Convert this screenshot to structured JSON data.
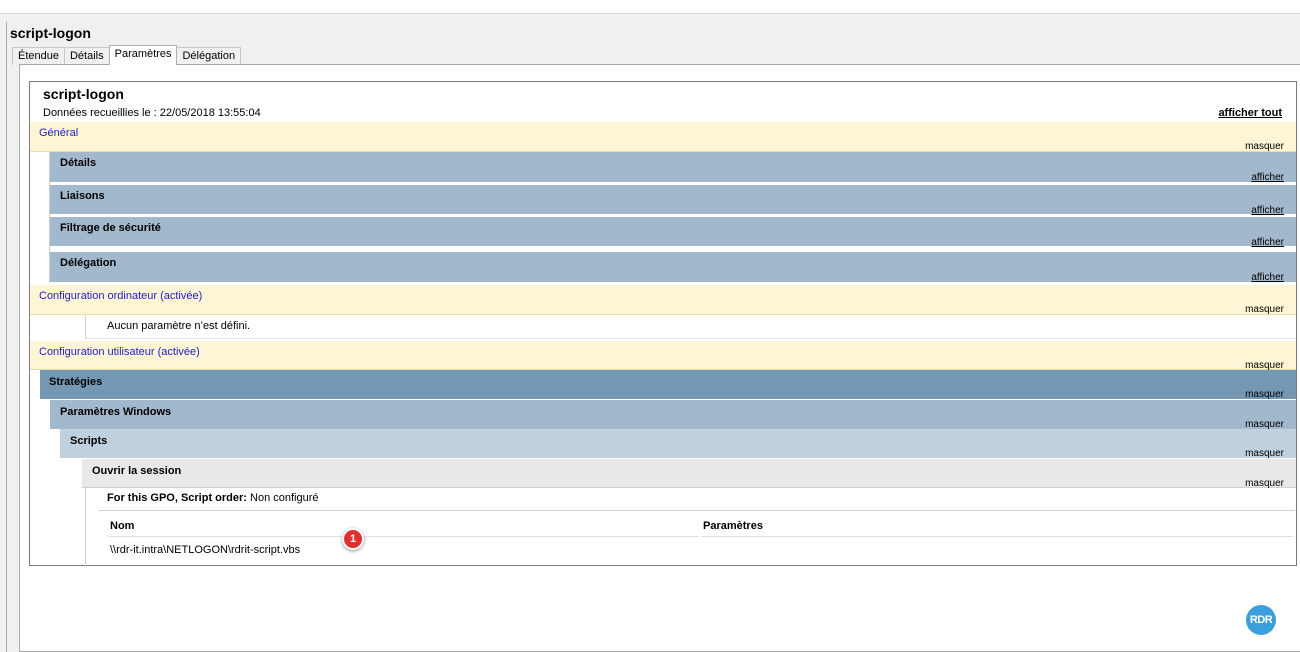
{
  "window": {
    "title": "script-logon"
  },
  "tabs": [
    {
      "label": "Étendue"
    },
    {
      "label": "Détails"
    },
    {
      "label": "Paramètres"
    },
    {
      "label": "Délégation"
    }
  ],
  "report": {
    "title": "script-logon",
    "collected": "Données recueillies le : 22/05/2018 13:55:04",
    "show_all": "afficher tout",
    "general": {
      "label": "Général",
      "action": "masquer"
    },
    "sections": [
      {
        "label": "Détails",
        "action": "afficher"
      },
      {
        "label": "Liaisons",
        "action": "afficher"
      },
      {
        "label": "Filtrage de sécurité",
        "action": "afficher"
      },
      {
        "label": "Délégation",
        "action": "afficher"
      }
    ],
    "computer_config": {
      "label": "Configuration ordinateur (activée)",
      "action": "masquer",
      "empty": "Aucun paramètre n’est défini."
    },
    "user_config": {
      "label": "Configuration utilisateur (activée)",
      "action": "masquer"
    },
    "strategies": {
      "label": "Stratégies",
      "action": "masquer"
    },
    "windows_params": {
      "label": "Paramètres Windows",
      "action": "masquer"
    },
    "scripts": {
      "label": "Scripts",
      "action": "masquer"
    },
    "logon": {
      "label": "Ouvrir la session",
      "action": "masquer"
    },
    "gpo_order": {
      "label": "For this GPO, Script order:",
      "value": "Non configuré"
    },
    "table": {
      "headers": [
        "Nom",
        "Paramètres"
      ],
      "rows": [
        [
          "\\\\rdr-it.intra\\NETLOGON\\rdrit-script.vbs",
          ""
        ]
      ]
    }
  },
  "annotation": {
    "marker": "1"
  },
  "logo": {
    "text": "RDR"
  },
  "colors": {
    "category_bg": "#fdf5d5",
    "category_text": "#2020c8",
    "section_bg": "#a2b8cc",
    "strategy_bg": "#7498b4",
    "scripts_bg": "#bfd1de",
    "marker": "#e03030"
  }
}
